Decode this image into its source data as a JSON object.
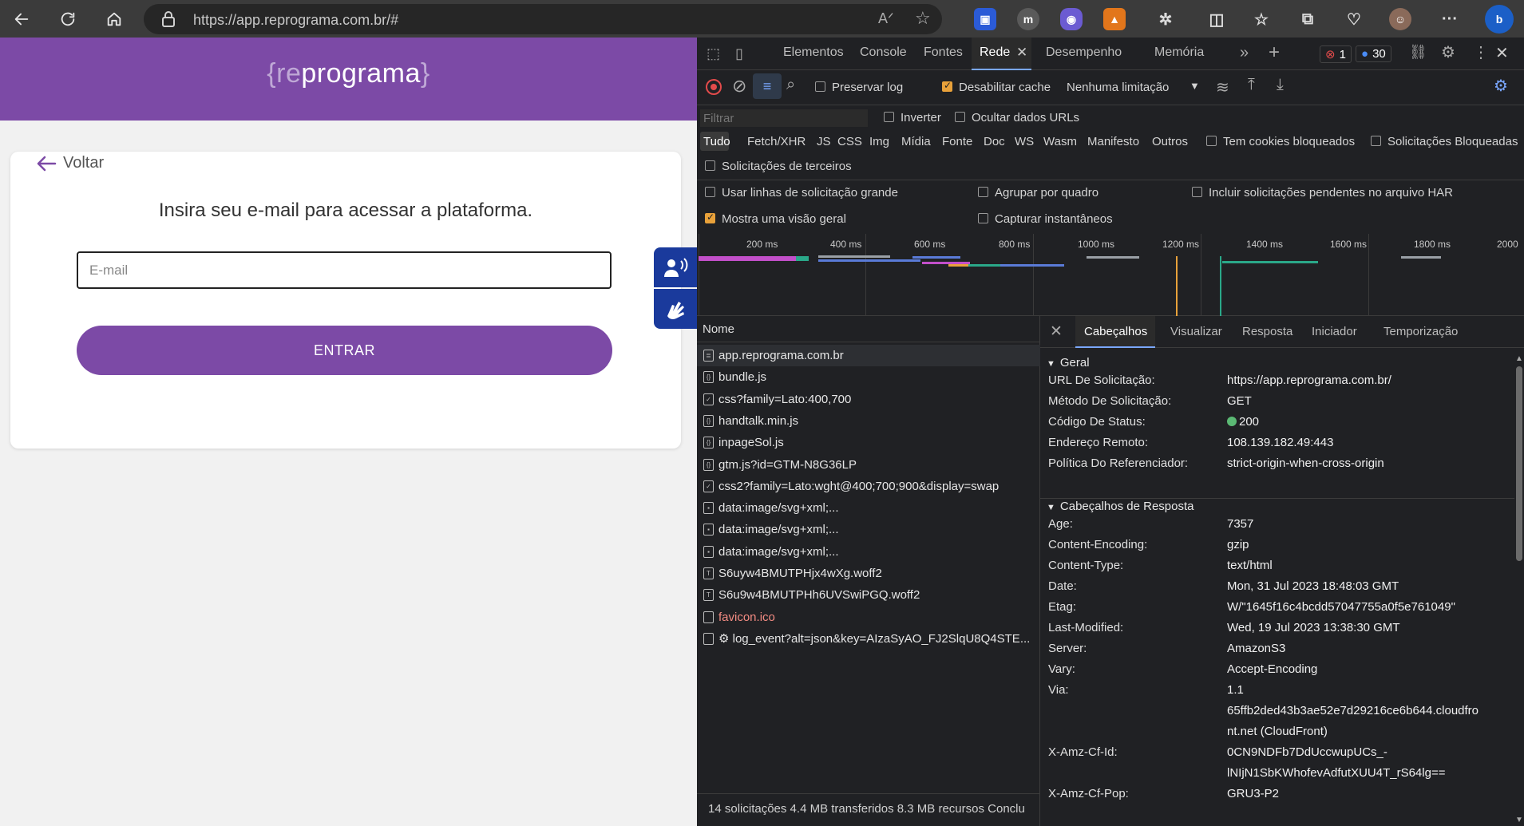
{
  "browser": {
    "url": "https://app.reprograma.com.br/#"
  },
  "page": {
    "logo": {
      "open": "{",
      "re": "re",
      "rest": "programa",
      "close": "}"
    },
    "back_label": "Voltar",
    "heading": "Insira seu e-mail para acessar a plataforma.",
    "email_placeholder": "E-mail",
    "enter_label": "ENTRAR"
  },
  "devtools": {
    "tabs": [
      "Elementos",
      "Console",
      "Fontes",
      "Rede",
      "Desempenho",
      "Memória"
    ],
    "active_tab": "Rede",
    "error_count": "1",
    "message_count": "30",
    "toolbar": {
      "preserve_log": "Preservar log",
      "disable_cache": "Desabilitar cache",
      "throttling": "Nenhuma limitação"
    },
    "filter": {
      "placeholder": "Filtrar",
      "invert": "Inverter",
      "hide_data_urls": "Ocultar dados URLs"
    },
    "type_filters": [
      "Tudo",
      "Fetch/XHR",
      "JS",
      "CSS",
      "Img",
      "Mídia",
      "Fonte",
      "Doc",
      "WS",
      "Wasm",
      "Manifesto",
      "Outros"
    ],
    "blocked_cookies": "Tem cookies bloqueados",
    "blocked_requests": "Solicitações Bloqueadas",
    "third_party": "Solicitações de terceiros",
    "options": {
      "big_rows": "Usar linhas de solicitação grande",
      "group_by_frame": "Agrupar por quadro",
      "include_pending": "Incluir solicitações pendentes no arquivo HAR",
      "overview": "Mostra uma visão geral",
      "screenshots": "Capturar instantâneos"
    },
    "timeline_ticks": [
      "200 ms",
      "400 ms",
      "600 ms",
      "800 ms",
      "1000 ms",
      "1200 ms",
      "1400 ms",
      "1600 ms",
      "1800 ms",
      "2000"
    ],
    "name_header": "Nome",
    "requests": [
      {
        "name": "app.reprograma.com.br",
        "icon": "doc"
      },
      {
        "name": "bundle.js",
        "icon": "js"
      },
      {
        "name": "css?family=Lato:400,700",
        "icon": "css"
      },
      {
        "name": "handtalk.min.js",
        "icon": "js"
      },
      {
        "name": "inpageSol.js",
        "icon": "js"
      },
      {
        "name": "gtm.js?id=GTM-N8G36LP",
        "icon": "js"
      },
      {
        "name": "css2?family=Lato:wght@400;700;900&display=swap",
        "icon": "css"
      },
      {
        "name": "data:image/svg+xml;...",
        "icon": "img"
      },
      {
        "name": "data:image/svg+xml;...",
        "icon": "img"
      },
      {
        "name": "data:image/svg+xml;...",
        "icon": "img"
      },
      {
        "name": "S6uyw4BMUTPHjx4wXg.woff2",
        "icon": "font"
      },
      {
        "name": "S6u9w4BMUTPHh6UVSwiPGQ.woff2",
        "icon": "font"
      },
      {
        "name": "favicon.ico",
        "icon": "other",
        "error": true
      },
      {
        "name": "⚙ log_event?alt=json&key=AIzaSyAO_FJ2SlqU8Q4STE...",
        "icon": "other"
      }
    ],
    "summary": "14 solicitações  4.4 MB transferidos  8.3 MB recursos  Conclu",
    "detail_tabs": [
      "Cabeçalhos",
      "Visualizar",
      "Resposta",
      "Iniciador",
      "Temporização"
    ],
    "active_detail_tab": "Cabeçalhos",
    "general_title": "Geral",
    "general": [
      {
        "k": "URL De Solicitação:",
        "v": "https://app.reprograma.com.br/"
      },
      {
        "k": "Método De Solicitação:",
        "v": "GET"
      },
      {
        "k": "Código De Status:",
        "v": "200"
      },
      {
        "k": "Endereço Remoto:",
        "v": "108.139.182.49:443"
      },
      {
        "k": "Política Do Referenciador:",
        "v": "strict-origin-when-cross-origin"
      }
    ],
    "response_title": "Cabeçalhos de Resposta",
    "response": [
      {
        "k": "Age:",
        "v": "7357"
      },
      {
        "k": "Content-Encoding:",
        "v": "gzip"
      },
      {
        "k": "Content-Type:",
        "v": "text/html"
      },
      {
        "k": "Date:",
        "v": "Mon, 31 Jul 2023 18:48:03 GMT"
      },
      {
        "k": "Etag:",
        "v": "W/\"1645f16c4bcdd57047755a0f5e761049\""
      },
      {
        "k": "Last-Modified:",
        "v": "Wed, 19 Jul 2023 13:38:30 GMT"
      },
      {
        "k": "Server:",
        "v": "AmazonS3"
      },
      {
        "k": "Vary:",
        "v": "Accept-Encoding"
      },
      {
        "k": "Via:",
        "v": "1.1"
      },
      {
        "k": "",
        "v": "65ffb2ded43b3ae52e7d29216ce6b644.cloudfro"
      },
      {
        "k": "",
        "v": "nt.net (CloudFront)"
      },
      {
        "k": "X-Amz-Cf-Id:",
        "v": "0CN9NDFb7DdUccwupUCs_-"
      },
      {
        "k": "",
        "v": "lNIjN1SbKWhofevAdfutXUU4T_rS64lg=="
      },
      {
        "k": "X-Amz-Cf-Pop:",
        "v": "GRU3-P2"
      }
    ],
    "colors": {
      "record": "#e34b4b",
      "status_ok": "#5bb974",
      "accent": "#e8a13a",
      "brand": "#7c4aa6"
    }
  }
}
